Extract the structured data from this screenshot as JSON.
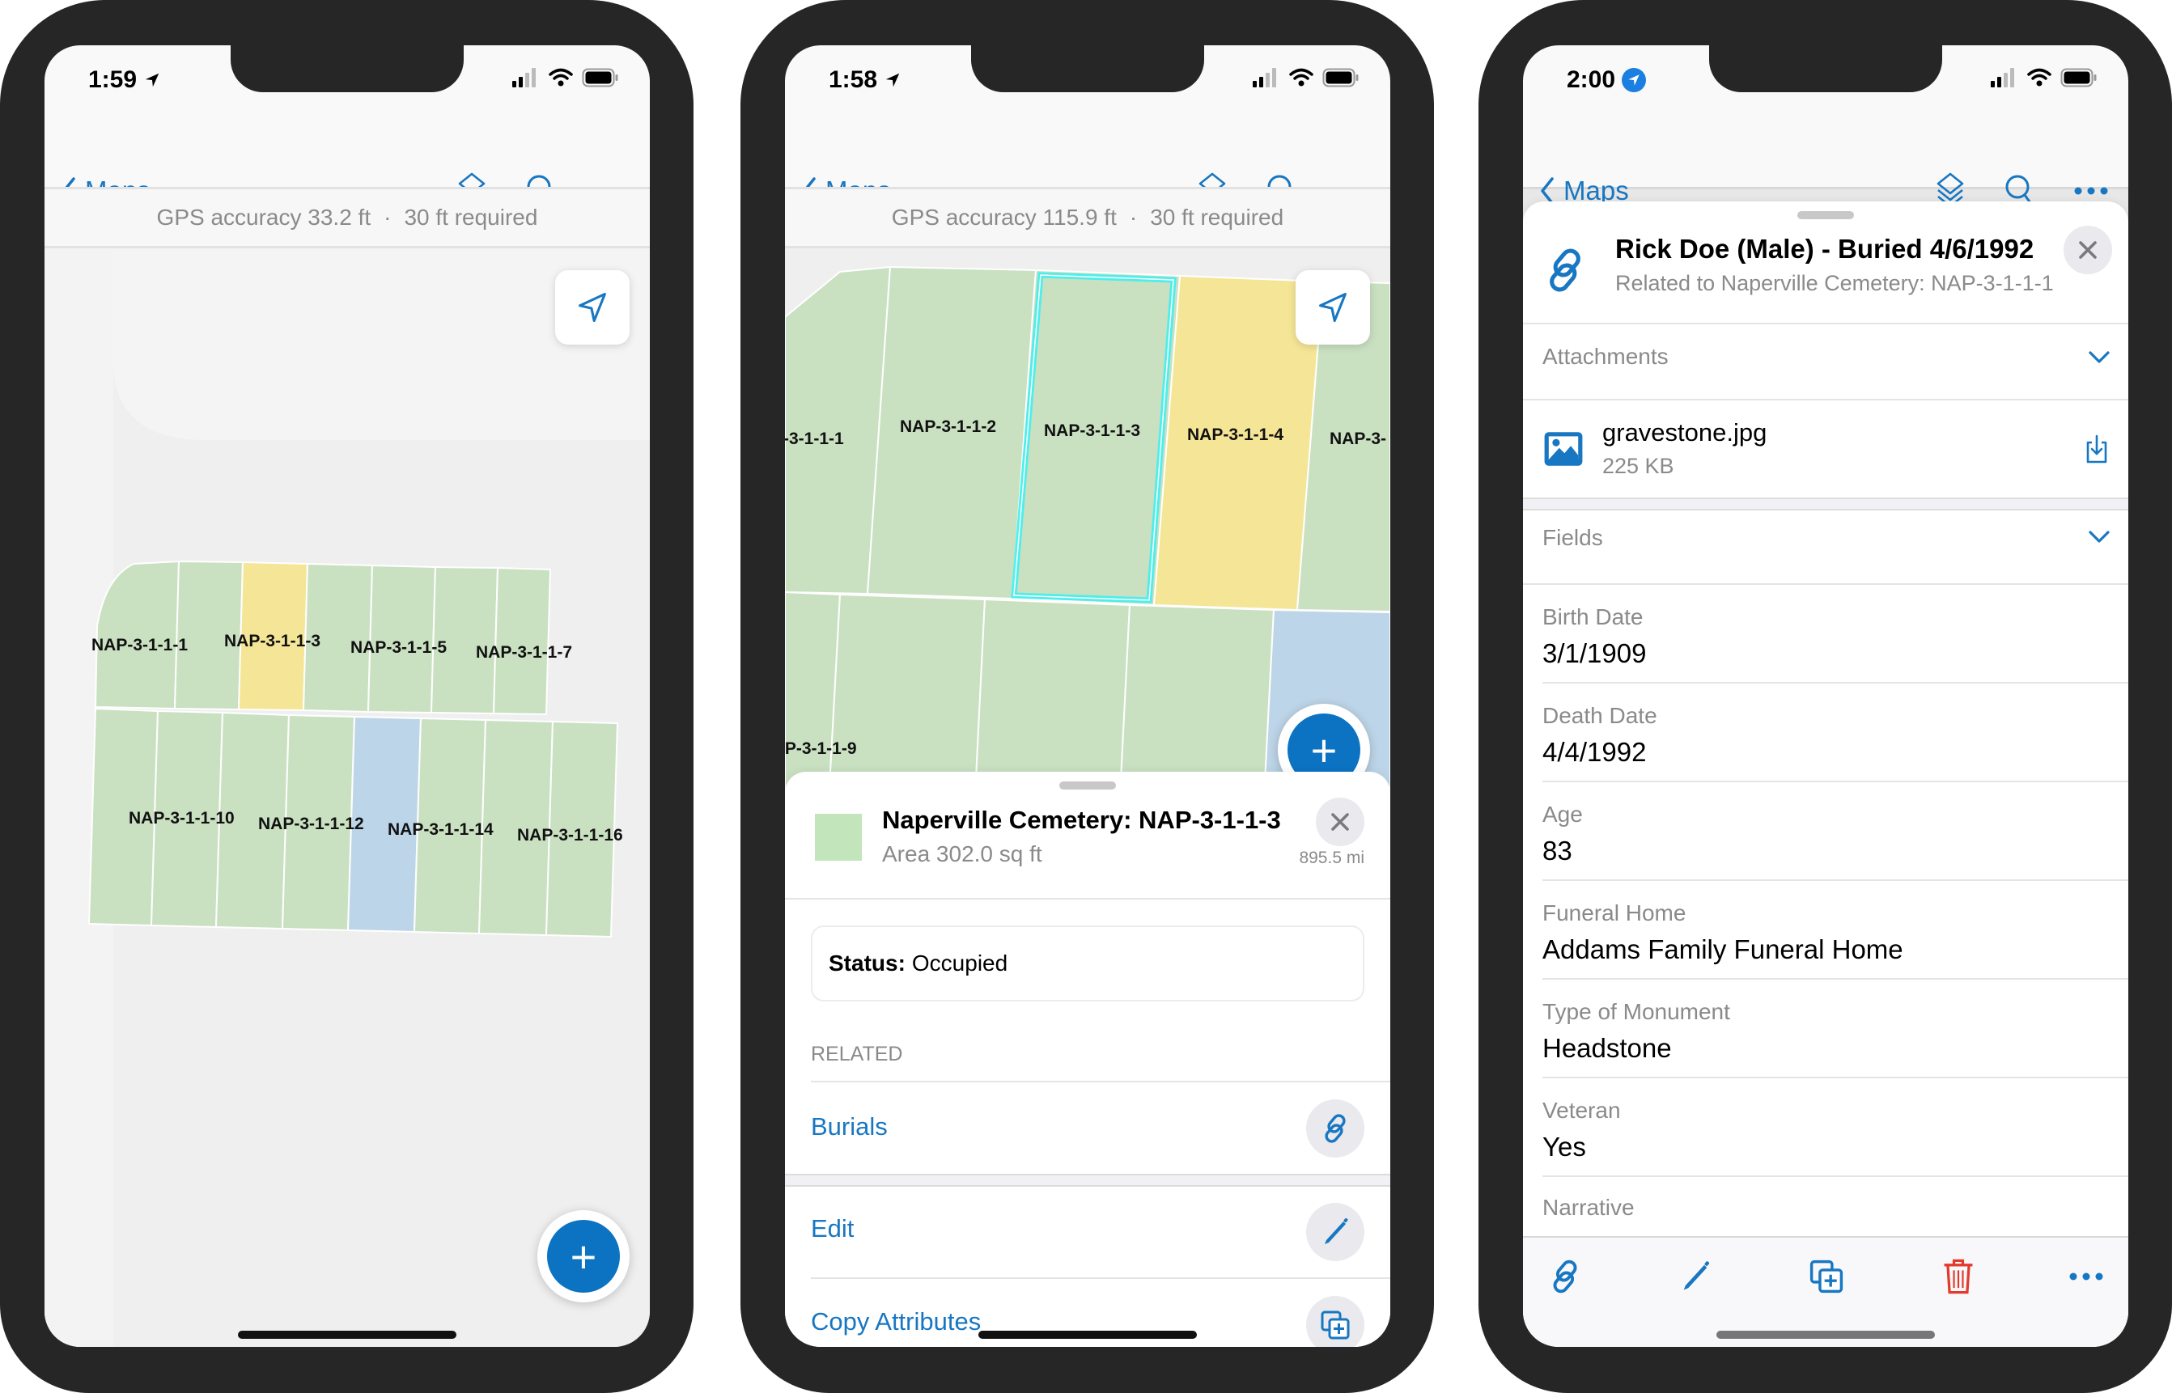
{
  "colors": {
    "accent": "#1877c2",
    "fab": "#0b73c2",
    "plot_available": "#c9e0c1",
    "plot_reserved": "#f5e596",
    "plot_other": "#bdd5e8",
    "selection": "#3ff0f0",
    "delete": "#e23b2e"
  },
  "phones": [
    {
      "status": {
        "time": "1:59",
        "location_icon": "location-arrow-icon"
      },
      "nav": {
        "back_label": "Maps",
        "icons": [
          "layers-icon",
          "search-icon",
          "more-icon"
        ]
      },
      "gps": {
        "accuracy": "GPS accuracy 33.2 ft",
        "separator": "·",
        "required": "30 ft required"
      },
      "map": {
        "plots": [
          {
            "label": "NAP-3-1-1-1",
            "status": "available"
          },
          {
            "label": "NAP-3-1-1-3",
            "status": "reserved"
          },
          {
            "label": "NAP-3-1-1-5",
            "status": "available"
          },
          {
            "label": "NAP-3-1-1-7",
            "status": "available"
          },
          {
            "label": "NAP-3-1-1-10",
            "status": "available"
          },
          {
            "label": "NAP-3-1-1-12",
            "status": "other"
          },
          {
            "label": "NAP-3-1-1-14",
            "status": "available"
          },
          {
            "label": "NAP-3-1-1-16",
            "status": "available"
          }
        ]
      },
      "fab_label": "+"
    },
    {
      "status": {
        "time": "1:58",
        "location_icon": "location-arrow-icon"
      },
      "nav": {
        "back_label": "Maps",
        "icons": [
          "layers-icon",
          "search-icon",
          "more-icon"
        ]
      },
      "gps": {
        "accuracy": "GPS accuracy 115.9 ft",
        "separator": "·",
        "required": "30 ft required"
      },
      "map": {
        "plots": [
          {
            "label": "-3-1-1-1",
            "status": "available"
          },
          {
            "label": "NAP-3-1-1-2",
            "status": "available"
          },
          {
            "label": "NAP-3-1-1-3",
            "status": "available",
            "selected": true
          },
          {
            "label": "NAP-3-1-1-4",
            "status": "reserved"
          },
          {
            "label": "NAP-3-",
            "status": "available"
          },
          {
            "label": "\\P-3-1-1-9",
            "status": "available"
          }
        ]
      },
      "fab_label": "+",
      "sheet": {
        "title": "Naperville Cemetery: NAP-3-1-1-3",
        "subtitle": "Area 302.0 sq ft",
        "distance": "895.5 mi",
        "status_label": "Status:",
        "status_value": "Occupied",
        "related_header": "RELATED",
        "related_items": [
          {
            "label": "Burials",
            "icon": "link-icon"
          }
        ],
        "actions": [
          {
            "label": "Edit",
            "icon": "pencil-icon"
          },
          {
            "label": "Copy Attributes",
            "icon": "copy-add-icon"
          }
        ]
      }
    },
    {
      "status": {
        "time": "2:00",
        "location_icon": "location-badge-icon"
      },
      "nav": {
        "back_label": "Maps",
        "icons": [
          "layers-icon",
          "search-icon",
          "more-icon"
        ]
      },
      "detail": {
        "title": "Rick Doe (Male) - Buried 4/6/1992",
        "subtitle": "Related to Naperville Cemetery: NAP-3-1-1-1",
        "attachments_header": "Attachments",
        "attachment": {
          "name": "gravestone.jpg",
          "size": "225 KB"
        },
        "fields_header": "Fields",
        "fields": [
          {
            "label": "Birth Date",
            "value": "3/1/1909"
          },
          {
            "label": "Death Date",
            "value": "4/4/1992"
          },
          {
            "label": "Age",
            "value": "83"
          },
          {
            "label": "Funeral Home",
            "value": "Addams Family Funeral Home"
          },
          {
            "label": "Type of Monument",
            "value": "Headstone"
          },
          {
            "label": "Veteran",
            "value": "Yes"
          },
          {
            "label": "Narrative",
            "value": ""
          }
        ],
        "toolbar": [
          "link-icon",
          "pencil-icon",
          "copy-add-icon",
          "trash-icon",
          "more-icon"
        ]
      }
    }
  ]
}
